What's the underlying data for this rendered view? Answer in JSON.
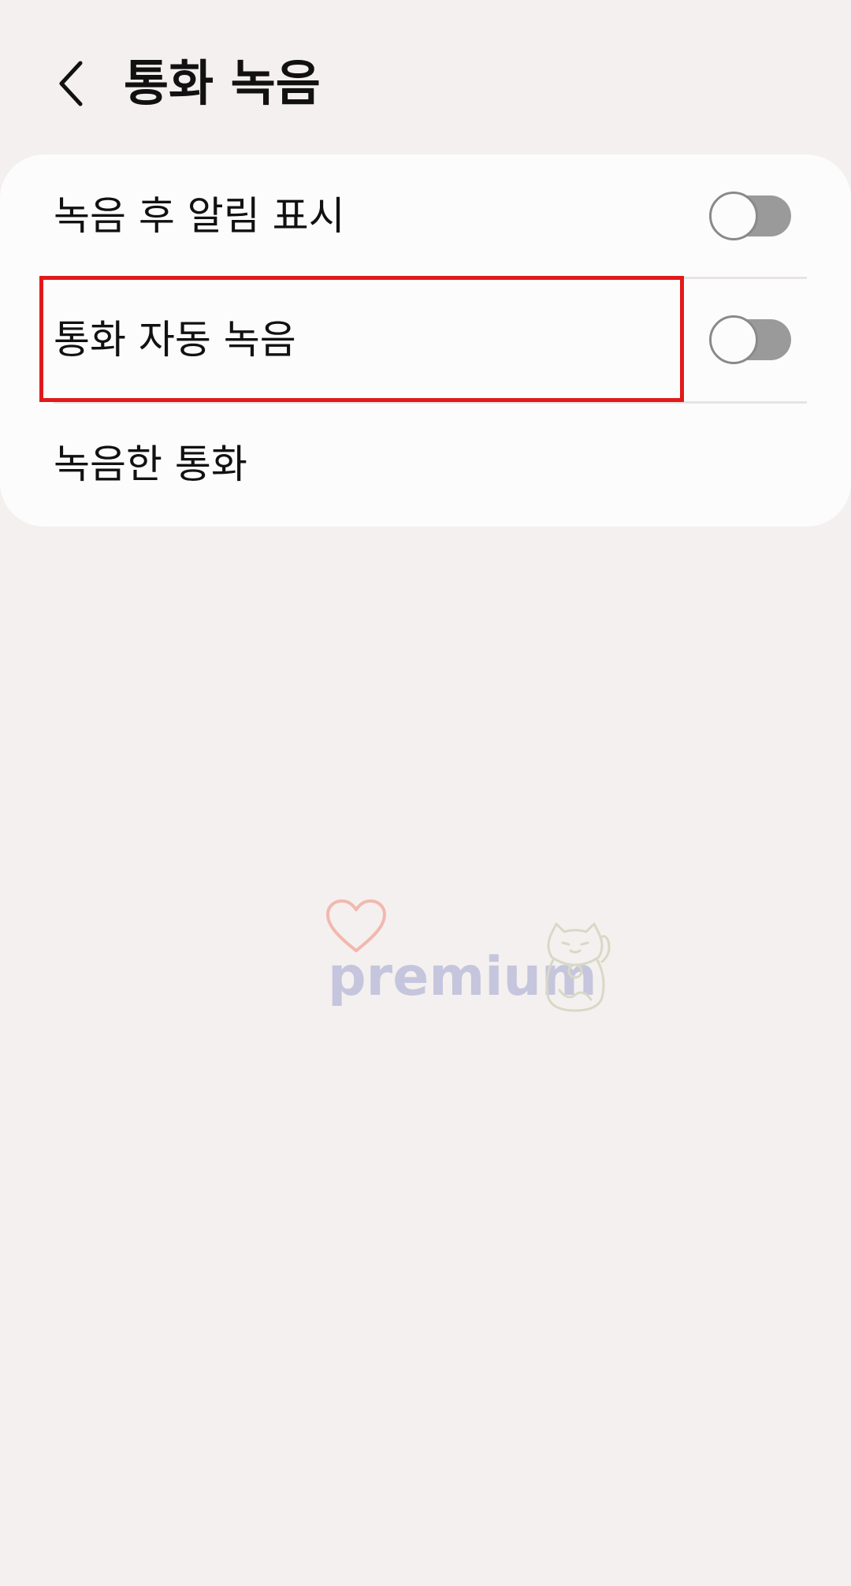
{
  "header": {
    "title": "통화 녹음"
  },
  "settings": {
    "items": [
      {
        "label": "녹음 후 알림 표시",
        "toggle_on": false
      },
      {
        "label": "통화 자동 녹음",
        "toggle_on": false,
        "highlighted": true
      },
      {
        "label": "녹음한 통화"
      }
    ]
  },
  "watermark": {
    "text": "premium"
  },
  "colors": {
    "background": "#f4f0ef",
    "card": "#fcfcfc",
    "toggle_track_off": "#9a9a9a",
    "highlight": "#e01a1a",
    "watermark_text": "#c5c6dd",
    "watermark_heart": "#f2b8ae"
  },
  "icons": {
    "back": "chevron-left-icon",
    "watermark_heart": "heart-icon",
    "watermark_cat": "lucky-cat-icon"
  }
}
